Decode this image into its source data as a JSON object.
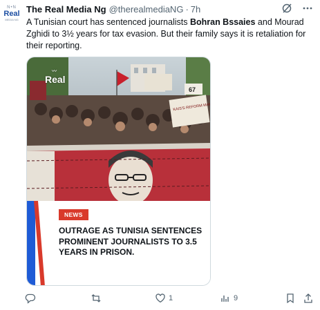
{
  "author": {
    "avatar_top": "N•N",
    "avatar_main": "Real",
    "avatar_sub": "MEDIA NG",
    "display_name": "The Real Media Ng",
    "handle": "@therealmediaNG",
    "separator": "·",
    "time": "7h"
  },
  "tweet": {
    "text_pre": "A Tunisian court has sentenced journalists ",
    "text_bold": "Bohran Bssaies",
    "text_post": " and Mourad Zghidi to 3½ years for tax evasion. But their family says it is retaliation for their reporting."
  },
  "media": {
    "logo": "Real",
    "logo_wave": "〰",
    "badge": "NEWS",
    "headline": "OUTRAGE AS TUNISIA SENTENCES PROMINENT JOURNALISTS TO 3.5 YEARS IN PRISON.",
    "sign_number": "67",
    "sign_text": "KAIS'S REFORM MAKING INJUSTICE"
  },
  "actions": {
    "replies": "",
    "retweets": "",
    "likes": "1",
    "views": "9"
  },
  "colors": {
    "accent_blue": "#1f5bd6",
    "accent_red": "#d93a2b",
    "banner_red": "#b8303a",
    "icon_gray": "#536471"
  },
  "icons": [
    "grok-slash-icon",
    "more-icon",
    "reply-icon",
    "retweet-icon",
    "like-icon",
    "views-icon",
    "bookmark-icon",
    "share-icon"
  ]
}
